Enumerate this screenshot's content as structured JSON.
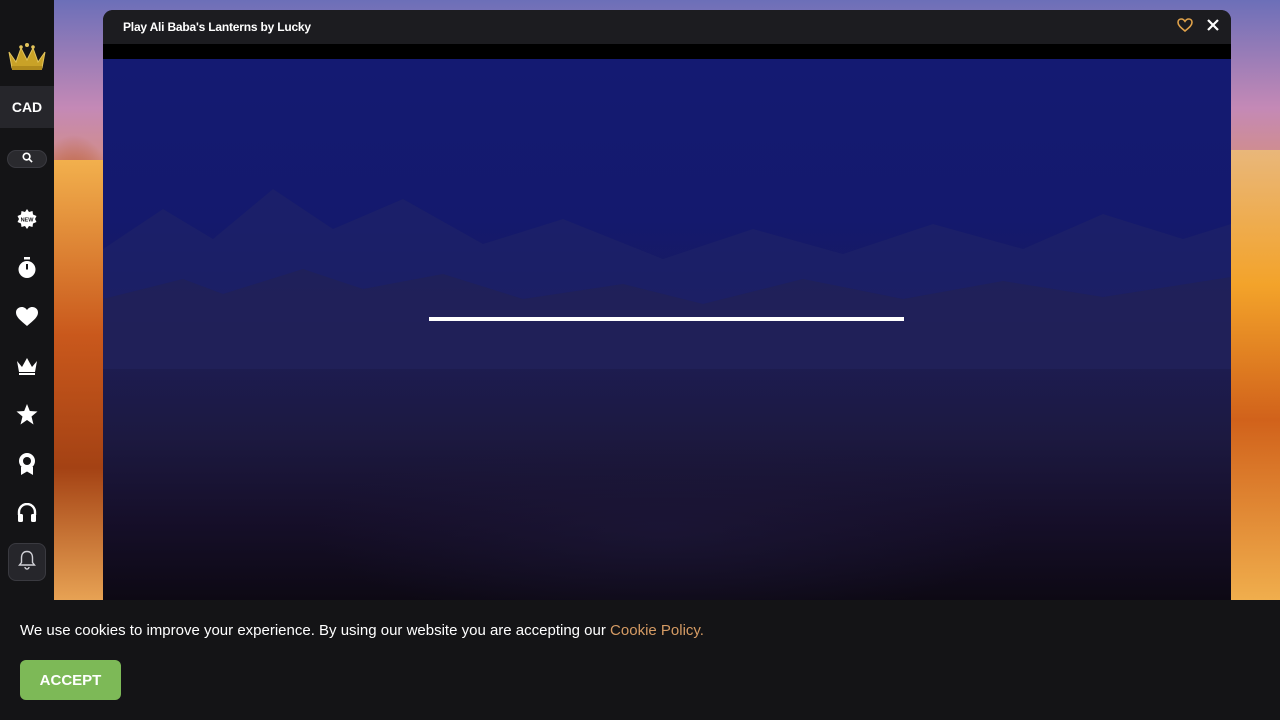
{
  "sidebar": {
    "currency": "CAD",
    "icons": [
      "new-games-icon",
      "timer-icon",
      "heart-icon",
      "crown-icon",
      "star-icon",
      "award-icon",
      "headset-icon",
      "bell-icon"
    ]
  },
  "modal": {
    "title": "Play Ali Baba's Lanterns by Lucky"
  },
  "game": {
    "loading_progress": 1.0
  },
  "cookie": {
    "text": "We use cookies to improve your experience. By using our website you are accepting our ",
    "link_text": "Cookie Policy.",
    "accept_label": "ACCEPT"
  },
  "colors": {
    "accent_green": "#7db957",
    "link_orange": "#d59b64",
    "sidebar_bg": "#141416",
    "favorite_icon": "#e0a24a"
  }
}
